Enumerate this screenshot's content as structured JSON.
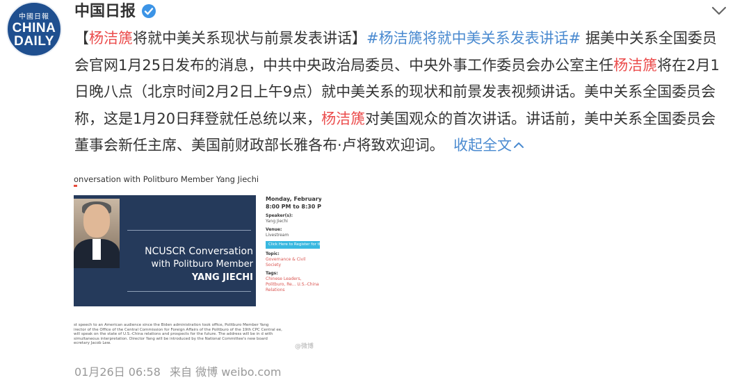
{
  "account": {
    "avatar_small": "中國日報",
    "avatar_line1": "CHINA",
    "avatar_line2": "DAILY",
    "name": "中国日报"
  },
  "post": {
    "seg1": "【",
    "seg2": "杨洁篪",
    "seg3": "将就中美关系现状与前景发表讲话】",
    "seg4": "#杨洁篪将就中美关系发表讲话#",
    "seg5": " 据美中关系全国委员会官网1月25日发布的消息，中共中央政治局委员、中央外事工作委员会办公室主任",
    "seg6": "杨洁篪",
    "seg7": "将在2月1日晚八点（北京时间2月2日上午9点）就中美关系的现状和前景发表视频讲话。美中关系全国委员会称，这是1月20日拜登就任总统以来，",
    "seg8": "杨洁篪",
    "seg9": "对美国观众的首次讲话。讲话前，美中关系全国委员会董事会新任主席、美国前财政部长雅各布·卢将致欢迎词。",
    "collapse_label": "收起全文"
  },
  "media": {
    "title": "onversation with Politburo Member Yang Jiechi",
    "banner_line1": "NCUSCR Conversation",
    "banner_line2": "with Politburo Member",
    "banner_line3": "YANG JIECHI",
    "side_date1": "Monday, February",
    "side_date2": "8:00 PM to 8:30 PM",
    "side_speakers_label": "Speaker(s):",
    "side_speakers": "Yang Jiechi",
    "side_venue_label": "Venue:",
    "side_venue": "Livestream",
    "side_button": "Click Here to Register for the",
    "side_topic_label": "Topic:",
    "side_topic": "Governance & Civil Society",
    "side_tags_label": "Tags:",
    "side_tags": "Chinese Leaders, Politburo, Re... U.S.-China Relations",
    "caption": "st speech to an American audience since the Biden administration took office, Politburo Member Yang irector of the Office of the Central Commission for Foreign Affairs of the Politburo of the 19th CPC Central ee, will speak on the state of U.S.-China relations and prospects for the future. The address will be in d with simultaneous interpretation. Director Yang will be introduced by the National Committee's new board ecretary Jacob Lew.",
    "watermark": "@微博"
  },
  "footer": {
    "time": "01月26日 06:58",
    "source": "来自 微博 weibo.com"
  },
  "icons": {
    "verified": "verified-badge-icon",
    "more": "chevron-down-icon",
    "collapse": "chevron-up-icon"
  },
  "colors": {
    "highlight_red": "#eb4c4c",
    "link_blue": "#4a8ad0",
    "verified_blue": "#3c94e6",
    "meta_gray": "#999999",
    "banner_navy": "#253a5b"
  }
}
